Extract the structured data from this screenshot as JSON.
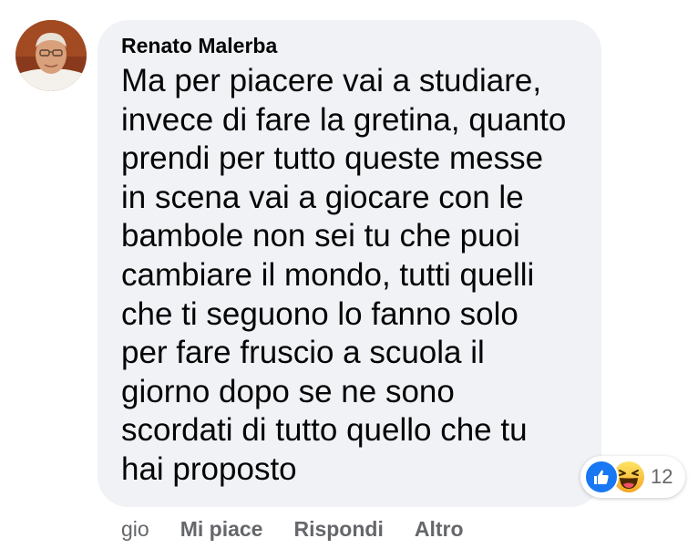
{
  "comment": {
    "author": "Renato Malerba",
    "text": "Ma per piacere vai a studiare,\ninvece di fare la gretina, quanto\nprendi per tutto queste messe\nin scena vai a giocare con le\nbambole non sei tu che puoi\ncambiare il mondo, tutti quelli\nche ti seguono lo fanno solo\nper fare fruscio a scuola il\ngiorno dopo se ne sono\nscordati di tutto quello che tu\nhai proposto",
    "avatar_icon": "user-avatar-photo",
    "bubble_color": "#f0f2f5"
  },
  "reactions": {
    "icons": [
      "like-icon",
      "haha-icon"
    ],
    "count": "12",
    "like_color": "#1877f2",
    "haha_color": "#f7b125"
  },
  "actions": {
    "time": "gio",
    "like_label": "Mi piace",
    "reply_label": "Rispondi",
    "more_label": "Altro",
    "text_color": "#65676b"
  }
}
